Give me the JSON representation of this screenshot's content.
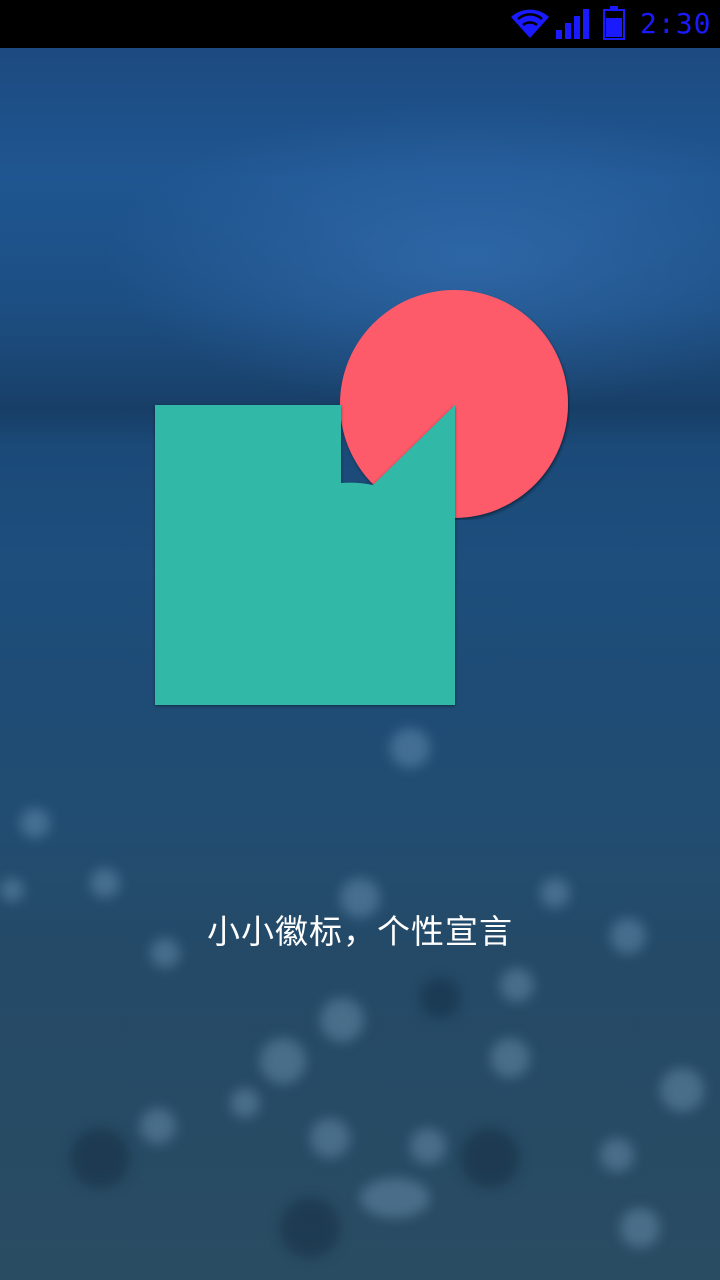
{
  "status_bar": {
    "time": "2:30",
    "icons": [
      "wifi-icon",
      "signal-icon",
      "battery-icon"
    ],
    "icon_color": "#1a1aff"
  },
  "splash": {
    "tagline": "小小徽标，个性宣言",
    "square_color": "#31b8a7",
    "circle_color": "#fd5a6a"
  }
}
